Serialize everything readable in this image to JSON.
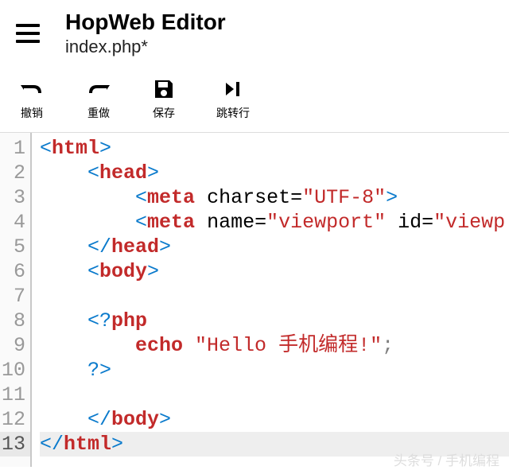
{
  "header": {
    "app_title": "HopWeb Editor",
    "file_name": "index.php*"
  },
  "toolbar": {
    "undo": "撤销",
    "redo": "重做",
    "save": "保存",
    "goto": "跳转行"
  },
  "editor": {
    "line_numbers": [
      "1",
      "2",
      "3",
      "4",
      "5",
      "6",
      "7",
      "8",
      "9",
      "10",
      "11",
      "12",
      "13"
    ],
    "active_line": 13,
    "code": [
      {
        "indent": 0,
        "tokens": [
          {
            "t": "tag-bracket",
            "v": "<"
          },
          {
            "t": "tag-name",
            "v": "html"
          },
          {
            "t": "tag-bracket",
            "v": ">"
          }
        ]
      },
      {
        "indent": 1,
        "tokens": [
          {
            "t": "tag-bracket",
            "v": "<"
          },
          {
            "t": "tag-name",
            "v": "head"
          },
          {
            "t": "tag-bracket",
            "v": ">"
          }
        ]
      },
      {
        "indent": 2,
        "tokens": [
          {
            "t": "tag-bracket",
            "v": "<"
          },
          {
            "t": "tag-name",
            "v": "meta"
          },
          {
            "t": "attr-name",
            "v": " charset="
          },
          {
            "t": "attr-val",
            "v": "\"UTF-8\""
          },
          {
            "t": "tag-bracket",
            "v": ">"
          }
        ]
      },
      {
        "indent": 2,
        "tokens": [
          {
            "t": "tag-bracket",
            "v": "<"
          },
          {
            "t": "tag-name",
            "v": "meta"
          },
          {
            "t": "attr-name",
            "v": " name="
          },
          {
            "t": "attr-val",
            "v": "\"viewport\""
          },
          {
            "t": "attr-name",
            "v": " id="
          },
          {
            "t": "attr-val",
            "v": "\"viewp"
          }
        ]
      },
      {
        "indent": 1,
        "tokens": [
          {
            "t": "tag-bracket",
            "v": "</"
          },
          {
            "t": "tag-name",
            "v": "head"
          },
          {
            "t": "tag-bracket",
            "v": ">"
          }
        ]
      },
      {
        "indent": 1,
        "tokens": [
          {
            "t": "tag-bracket",
            "v": "<"
          },
          {
            "t": "tag-name",
            "v": "body"
          },
          {
            "t": "tag-bracket",
            "v": ">"
          }
        ]
      },
      {
        "indent": 0,
        "tokens": []
      },
      {
        "indent": 1,
        "tokens": [
          {
            "t": "php-open",
            "v": "<?"
          },
          {
            "t": "php-kw",
            "v": "php"
          }
        ]
      },
      {
        "indent": 2,
        "tokens": [
          {
            "t": "php-kw",
            "v": "echo "
          },
          {
            "t": "string",
            "v": "\"Hello 手机编程!\""
          },
          {
            "t": "semi",
            "v": ";"
          }
        ]
      },
      {
        "indent": 1,
        "tokens": [
          {
            "t": "php-open",
            "v": "?>"
          }
        ]
      },
      {
        "indent": 0,
        "tokens": []
      },
      {
        "indent": 1,
        "tokens": [
          {
            "t": "tag-bracket",
            "v": "</"
          },
          {
            "t": "tag-name",
            "v": "body"
          },
          {
            "t": "tag-bracket",
            "v": ">"
          }
        ]
      },
      {
        "indent": 0,
        "tokens": [
          {
            "t": "tag-bracket",
            "v": "</"
          },
          {
            "t": "tag-name",
            "v": "html"
          },
          {
            "t": "tag-bracket",
            "v": ">"
          }
        ]
      }
    ]
  },
  "watermark": "头条号 / 手机编程"
}
